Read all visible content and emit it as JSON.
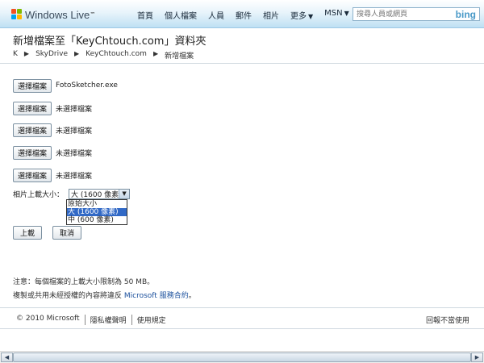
{
  "header": {
    "logo_text": "Windows Live",
    "logo_tm": "™",
    "nav": [
      {
        "label": "首頁",
        "arrow": ""
      },
      {
        "label": "個人檔案",
        "arrow": ""
      },
      {
        "label": "人員",
        "arrow": ""
      },
      {
        "label": "郵件",
        "arrow": ""
      },
      {
        "label": "相片",
        "arrow": ""
      },
      {
        "label": "更多",
        "arrow": "▼"
      },
      {
        "label": "MSN",
        "arrow": "▼"
      }
    ],
    "search_placeholder": "搜尋人員或網頁",
    "search_brand": "bing"
  },
  "page": {
    "title": "新增檔案至「KeyChtouch.com」資料夾",
    "breadcrumb": [
      "K",
      "SkyDrive",
      "KeyChtouch.com",
      "新增檔案"
    ],
    "breadcrumb_sep": "▶"
  },
  "files": [
    {
      "button": "選擇檔案",
      "name": "FotoSketcher.exe"
    },
    {
      "button": "選擇檔案",
      "name": "未選擇檔案"
    },
    {
      "button": "選擇檔案",
      "name": "未選擇檔案"
    },
    {
      "button": "選擇檔案",
      "name": "未選擇檔案"
    },
    {
      "button": "選擇檔案",
      "name": "未選擇檔案"
    }
  ],
  "photo_size": {
    "label": "相片上載大小：",
    "selected": "大 (1600 像素)",
    "options": [
      "原始大小",
      "大 (1600 像素)",
      "中 (600 像素)"
    ],
    "highlighted_index": 1
  },
  "actions": {
    "upload": "上載",
    "cancel": "取消"
  },
  "notes": {
    "line1": "注意：每個檔案的上載大小限制為 50 MB。",
    "line2_prefix": "複製或共用未經授權的內容將違反 ",
    "line2_link": "Microsoft 服務合約",
    "line2_suffix": "。"
  },
  "footer": {
    "copyright": "© 2010 Microsoft",
    "links": [
      "隱私權聲明",
      "使用規定"
    ],
    "report": "回報不當使用"
  },
  "colors": {
    "accent": "#3169c6",
    "link": "#1a4f9c",
    "header_bottom": "#bfe0f3"
  }
}
